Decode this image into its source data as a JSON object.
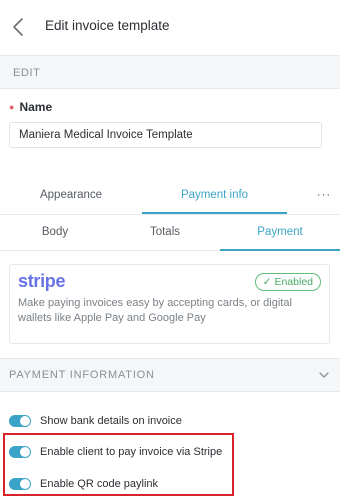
{
  "header": {
    "title": "Edit invoice template"
  },
  "edit_section": {
    "label": "EDIT"
  },
  "name_field": {
    "label": "Name",
    "value": "Maniera Medical Invoice Template"
  },
  "primary_tabs": [
    {
      "label": "Appearance",
      "active": false
    },
    {
      "label": "Payment info",
      "active": true
    },
    {
      "label": "···"
    }
  ],
  "secondary_tabs": [
    {
      "label": "Body",
      "active": false
    },
    {
      "label": "Totals",
      "active": false
    },
    {
      "label": "Payment",
      "active": true
    }
  ],
  "stripe_card": {
    "logo": "stripe",
    "badge": "✓ Enabled",
    "description": "Make paying invoices easy by accepting cards, or digital wallets like Apple Pay and Google Pay"
  },
  "payment_information": {
    "label": "PAYMENT INFORMATION"
  },
  "toggles": [
    {
      "label": "Show bank details on invoice",
      "on": true
    },
    {
      "label": "Enable client to pay invoice via Stripe",
      "on": true
    },
    {
      "label": "Enable QR code paylink",
      "on": true
    }
  ],
  "colors": {
    "accent": "#3aa3c7",
    "stripe": "#6772e5",
    "enabled": "#4aa866",
    "highlight": "#d9232a"
  }
}
